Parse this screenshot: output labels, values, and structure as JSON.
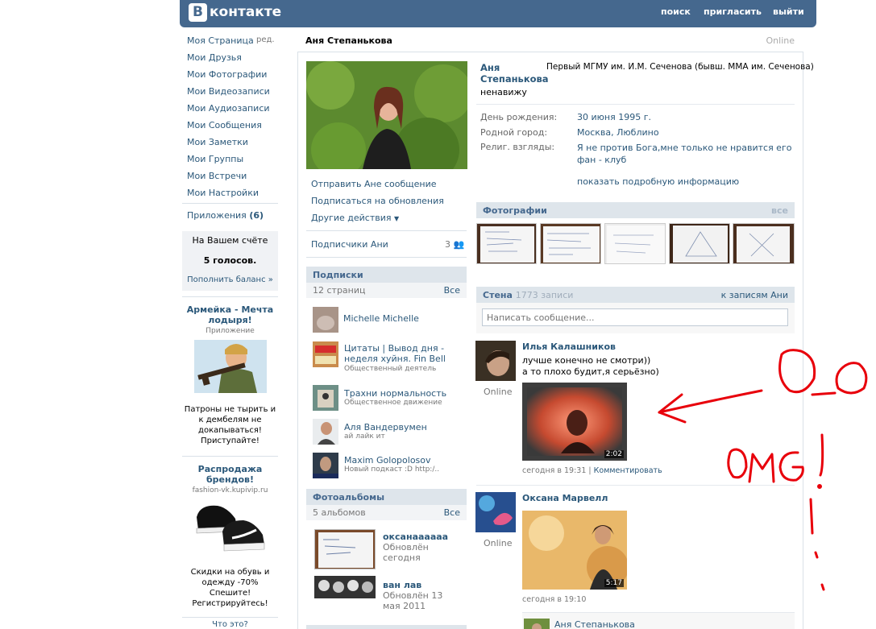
{
  "header": {
    "logo_letter": "В",
    "logo_text": "контакте",
    "nav": [
      "поиск",
      "пригласить",
      "выйти"
    ]
  },
  "menu": {
    "items": [
      "Моя Страница",
      "Мои Друзья",
      "Мои Фотографии",
      "Мои Видеозаписи",
      "Мои Аудиозаписи",
      "Мои Сообщения",
      "Мои Заметки",
      "Мои Группы",
      "Мои Встречи",
      "Мои Настройки"
    ],
    "edit_label": "ред.",
    "apps_label": "Приложения",
    "apps_count": "(6)"
  },
  "balance": {
    "title": "На Вашем счёте",
    "votes": "5 голосов.",
    "topup": "Пополнить баланс »"
  },
  "ads": [
    {
      "title": "Армейка - Мечта лодыря!",
      "sub": "Приложение",
      "text": "Патроны не тырить и к дембелям не докапываться! Приступайте!"
    },
    {
      "title": "Распродажа брендов!",
      "sub": "fashion-vk.kupivip.ru",
      "text": "Скидки на обувь и одежду -70% Спешите! Регистрируйтесь!"
    }
  ],
  "ads_footer": "Что это?",
  "profile": {
    "page_title": "Аня Степанькова",
    "online": "Online",
    "name": "Аня Степанькова",
    "status": "ненавижу",
    "university": "Первый МГМУ им. И.М. Сеченова (бывш. ММА им. Сеченова)",
    "info": [
      {
        "label": "День рождения:",
        "value": "30 июня 1995 г."
      },
      {
        "label": "Родной город:",
        "value": "Москва, Люблино"
      },
      {
        "label": "Религ. взгляды:",
        "value": "Я не против Бога,мне только не нравится его фан - клуб"
      }
    ],
    "more_info": "показать подробную информацию"
  },
  "actions": {
    "send_message": "Отправить Ане сообщение",
    "subscribe": "Подписаться на обновления",
    "other": "Другие действия",
    "followers": "Подписчики Ани",
    "followers_count": "3"
  },
  "subscriptions": {
    "title": "Подписки",
    "count": "12 страниц",
    "all": "Все",
    "items": [
      {
        "name": "Michelle Michelle",
        "sub": ""
      },
      {
        "name": "Цитаты | Вывод дня - неделя хуйня. Fin Bell",
        "sub": "Общественный деятель"
      },
      {
        "name": "Трахни нормальность",
        "sub": "Общественное движение"
      },
      {
        "name": "Аля Вандервумен",
        "sub": "ай лайк ит"
      },
      {
        "name": "Maxim Golopolosov",
        "sub": "Новый подкаст :D http:/.."
      }
    ]
  },
  "albums": {
    "title": "Фотоальбомы",
    "count": "5 альбомов",
    "all": "Все",
    "items": [
      {
        "name": "оксанаааааа",
        "sub": "Обновлён сегодня"
      },
      {
        "name": "ван лав",
        "sub": "Обновлён 13 мая 2011"
      }
    ]
  },
  "photos": {
    "title": "Фотографии",
    "all": "все"
  },
  "wall": {
    "title": "Стена",
    "count": "1773 записи",
    "to_posts": "к записям Ани",
    "placeholder": "Написать сообщение...",
    "posts": [
      {
        "author": "Илья Калашников",
        "online": "Online",
        "text1": "лучше конечно не смотри))",
        "text2": "а то плохо будит,я серьёзно)",
        "duration": "2:02",
        "time": "сегодня в 19:31",
        "comment": "Комментировать"
      },
      {
        "author": "Оксана Марвелл",
        "online": "Online",
        "duration": "5:17",
        "time": "сегодня в 19:10"
      }
    ],
    "reply_author": "Аня Степанькова"
  },
  "doodle": {
    "face": "O_o",
    "omg": "OMG!",
    "color": "#E8000B"
  },
  "colors": {
    "brand": "#45688E",
    "link": "#2B587A",
    "bar": "#DEE5EB"
  }
}
